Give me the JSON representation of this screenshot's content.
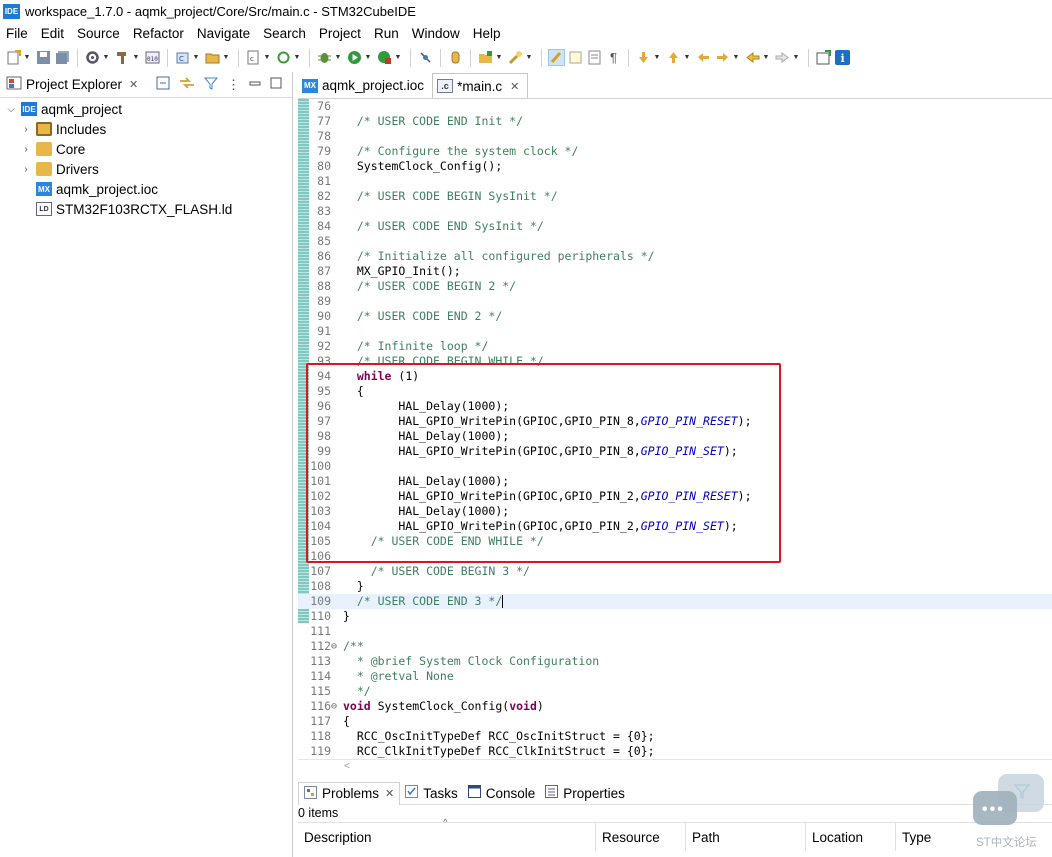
{
  "window": {
    "app_icon_label": "IDE",
    "title": "workspace_1.7.0 - aqmk_project/Core/Src/main.c - STM32CubeIDE"
  },
  "menu": [
    "File",
    "Edit",
    "Source",
    "Refactor",
    "Navigate",
    "Search",
    "Project",
    "Run",
    "Window",
    "Help"
  ],
  "project_explorer": {
    "tab_label": "Project Explorer",
    "items": [
      {
        "label": "aqmk_project",
        "icon": "project-icon",
        "icon_text": "IDE",
        "expanded": true,
        "level": 0
      },
      {
        "label": "Includes",
        "icon": "includes-icon",
        "expanded": false,
        "level": 1
      },
      {
        "label": "Core",
        "icon": "folder-icon",
        "expanded": false,
        "level": 1
      },
      {
        "label": "Drivers",
        "icon": "folder-icon",
        "expanded": false,
        "level": 1
      },
      {
        "label": "aqmk_project.ioc",
        "icon": "ioc-file-icon",
        "icon_text": "MX",
        "level": 1
      },
      {
        "label": "STM32F103RCTX_FLASH.ld",
        "icon": "linker-file-icon",
        "icon_text": "LD",
        "level": 1
      }
    ]
  },
  "editor": {
    "tabs": [
      {
        "label": "aqmk_project.ioc",
        "icon_text": "MX",
        "active": false
      },
      {
        "label": "*main.c",
        "icon_text": ".c",
        "active": true
      }
    ],
    "lines": [
      {
        "n": "76",
        "text": ""
      },
      {
        "n": "77",
        "text": "  /* USER CODE END Init */"
      },
      {
        "n": "78",
        "text": ""
      },
      {
        "n": "79",
        "text": "  /* Configure the system clock */"
      },
      {
        "n": "80",
        "text": "  SystemClock_Config();"
      },
      {
        "n": "81",
        "text": ""
      },
      {
        "n": "82",
        "text": "  /* USER CODE BEGIN SysInit */"
      },
      {
        "n": "83",
        "text": ""
      },
      {
        "n": "84",
        "text": "  /* USER CODE END SysInit */"
      },
      {
        "n": "85",
        "text": ""
      },
      {
        "n": "86",
        "text": "  /* Initialize all configured peripherals */"
      },
      {
        "n": "87",
        "text": "  MX_GPIO_Init();"
      },
      {
        "n": "88",
        "text": "  /* USER CODE BEGIN 2 */"
      },
      {
        "n": "89",
        "text": ""
      },
      {
        "n": "90",
        "text": "  /* USER CODE END 2 */"
      },
      {
        "n": "91",
        "text": ""
      },
      {
        "n": "92",
        "text": "  /* Infinite loop */"
      },
      {
        "n": "93",
        "text": "  /* USER CODE BEGIN WHILE */"
      },
      {
        "n": "94",
        "text": "  while (1)"
      },
      {
        "n": "95",
        "text": "  {"
      },
      {
        "n": "96",
        "text": "        HAL_Delay(1000);"
      },
      {
        "n": "97",
        "text": "        HAL_GPIO_WritePin(GPIOC,GPIO_PIN_8,GPIO_PIN_RESET);"
      },
      {
        "n": "98",
        "text": "        HAL_Delay(1000);"
      },
      {
        "n": "99",
        "text": "        HAL_GPIO_WritePin(GPIOC,GPIO_PIN_8,GPIO_PIN_SET);"
      },
      {
        "n": "100",
        "text": ""
      },
      {
        "n": "101",
        "text": "        HAL_Delay(1000);"
      },
      {
        "n": "102",
        "text": "        HAL_GPIO_WritePin(GPIOC,GPIO_PIN_2,GPIO_PIN_RESET);"
      },
      {
        "n": "103",
        "text": "        HAL_Delay(1000);"
      },
      {
        "n": "104",
        "text": "        HAL_GPIO_WritePin(GPIOC,GPIO_PIN_2,GPIO_PIN_SET);"
      },
      {
        "n": "105",
        "text": "    /* USER CODE END WHILE */"
      },
      {
        "n": "106",
        "text": ""
      },
      {
        "n": "107",
        "text": "    /* USER CODE BEGIN 3 */"
      },
      {
        "n": "108",
        "text": "  }"
      },
      {
        "n": "109",
        "text": "  /* USER CODE END 3 */"
      },
      {
        "n": "110",
        "text": "}"
      },
      {
        "n": "111",
        "text": ""
      },
      {
        "n": "112",
        "text": "/**"
      },
      {
        "n": "113",
        "text": "  * @brief System Clock Configuration"
      },
      {
        "n": "114",
        "text": "  * @retval None"
      },
      {
        "n": "115",
        "text": "  */"
      },
      {
        "n": "116",
        "text": "void SystemClock_Config(void)"
      },
      {
        "n": "117",
        "text": "{"
      },
      {
        "n": "118",
        "text": "  RCC_OscInitTypeDef RCC_OscInitStruct = {0};"
      },
      {
        "n": "119",
        "text": "  RCC_ClkInitTypeDef RCC_ClkInitStruct = {0};"
      }
    ]
  },
  "bottom_panel": {
    "tabs": [
      "Problems",
      "Tasks",
      "Console",
      "Properties"
    ],
    "status": "0 items",
    "columns": [
      "Description",
      "Resource",
      "Path",
      "Location",
      "Type"
    ]
  },
  "watermark": {
    "text": "ST中文论坛"
  },
  "colors": {
    "comment": "#3f7f5f",
    "keyword": "#7f0055",
    "constant": "#0000c0",
    "highlight_box": "#e0151c"
  }
}
